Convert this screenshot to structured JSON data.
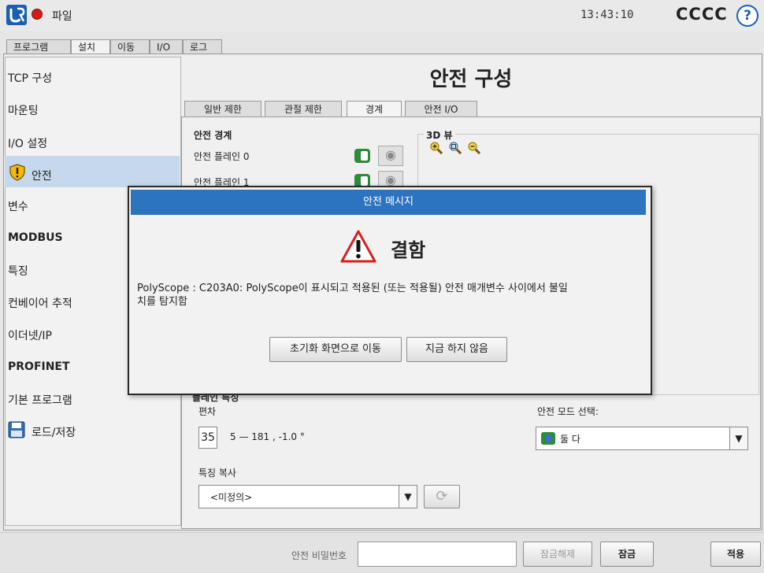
{
  "topbar": {
    "file_menu": "파일",
    "clock": "13:43:10",
    "robot_name": "CCCC",
    "help_label": "?"
  },
  "tabs": [
    "프로그램",
    "설치",
    "이동",
    "I/O",
    "로그"
  ],
  "nav": {
    "items": [
      "TCP 구성",
      "마운팅",
      "I/O 설정",
      "안전",
      "변수",
      "MODBUS",
      "특징",
      "컨베이어 추적",
      "이더넷/IP",
      "PROFINET",
      "기본 프로그램",
      "로드/저장"
    ]
  },
  "page_title": "안전 구성",
  "subtabs": [
    "일반 제한",
    "관절 제한",
    "경계",
    "안전 I/O"
  ],
  "boundaries": {
    "title": "안전 경계",
    "plane0": "안전 플레인 0",
    "plane1": "안전 플레인 1"
  },
  "view3d": {
    "title": "3D 뷰"
  },
  "props": {
    "section": "플레인 특성",
    "offset_label": "편차",
    "offset_box": "35",
    "offset_value": "5 — 181 , -1.0 °",
    "copy_label": "특징 복사",
    "copy_value": "<미정의>",
    "mode_label": "안전 모드 선택:",
    "mode_value": "둘 다"
  },
  "footer": {
    "password_label": "안전 비밀번호",
    "unlock": "잠금해제",
    "lock": "잠금",
    "apply": "적용"
  },
  "dialog": {
    "header": "안전 메시지",
    "title": "결함",
    "message_line1": "PolyScope : C203A0: PolyScope이 표시되고 적용된 (또는 적용될) 안전 매개변수 사이에서 불일",
    "message_line2": "치를 탐지함",
    "btn_reset": "초기화 화면으로 이동",
    "btn_later": "지금 하지 않음"
  },
  "colors": {
    "accent": "#2d74be",
    "toggle": "#2e8b3a",
    "warning": "#d62020",
    "nav_selected": "#c5d8ec"
  }
}
